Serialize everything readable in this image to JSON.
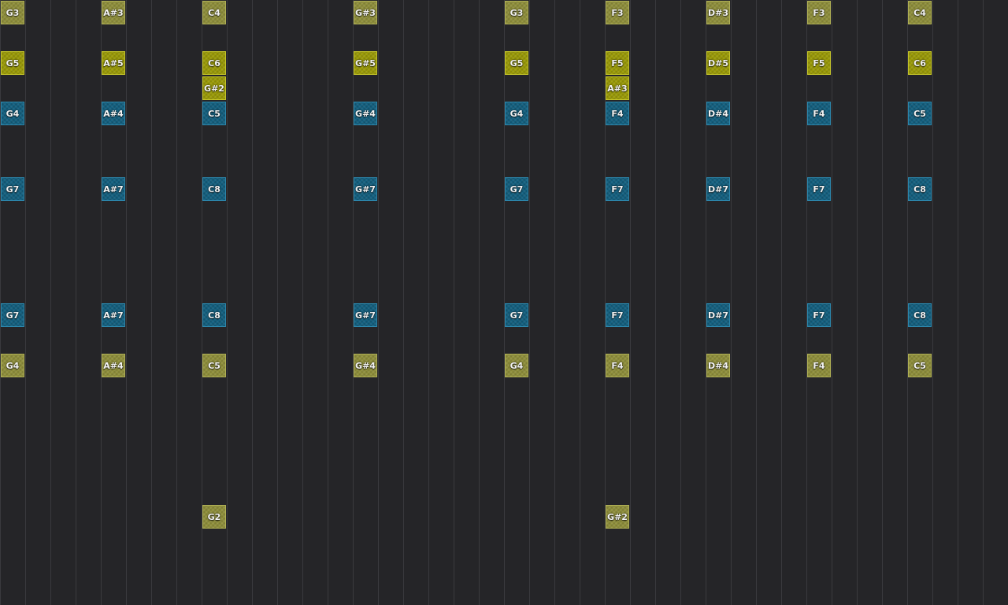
{
  "colors": {
    "background": "#252528",
    "gridline": "#3a3a3e",
    "olive": "#8e8e3a",
    "yellow": "#9a9a06",
    "blue": "#136080"
  },
  "columns": [
    {
      "rows": [
        {
          "label": "G3",
          "kind": "olive"
        },
        {
          "label": "G5",
          "kind": "yellow"
        },
        {
          "label": "G4",
          "kind": "blue"
        },
        {
          "label": "G7",
          "kind": "blue"
        },
        {
          "label": "G7",
          "kind": "blue"
        },
        {
          "label": "G4",
          "kind": "olive"
        }
      ]
    },
    {
      "rows": [
        {
          "label": "A#3",
          "kind": "olive"
        },
        {
          "label": "A#5",
          "kind": "yellow"
        },
        {
          "label": "A#4",
          "kind": "blue"
        },
        {
          "label": "A#7",
          "kind": "blue"
        },
        {
          "label": "A#7",
          "kind": "blue"
        },
        {
          "label": "A#4",
          "kind": "olive"
        }
      ]
    },
    {
      "rows": [
        {
          "label": "C4",
          "kind": "olive"
        },
        {
          "label": "C6",
          "kind": "yellow"
        },
        {
          "label": "G#2",
          "kind": "yellow"
        },
        {
          "label": "C5",
          "kind": "blue"
        },
        {
          "label": "C8",
          "kind": "blue"
        },
        {
          "label": "C8",
          "kind": "blue"
        },
        {
          "label": "C5",
          "kind": "olive"
        },
        {
          "label": "G2",
          "kind": "olive"
        }
      ]
    },
    {
      "rows": [
        {
          "label": "G#3",
          "kind": "olive"
        },
        {
          "label": "G#5",
          "kind": "yellow"
        },
        {
          "label": "G#4",
          "kind": "blue"
        },
        {
          "label": "G#7",
          "kind": "blue"
        },
        {
          "label": "G#7",
          "kind": "blue"
        },
        {
          "label": "G#4",
          "kind": "olive"
        }
      ]
    },
    {
      "rows": [
        {
          "label": "G3",
          "kind": "olive"
        },
        {
          "label": "G5",
          "kind": "yellow"
        },
        {
          "label": "G4",
          "kind": "blue"
        },
        {
          "label": "G7",
          "kind": "blue"
        },
        {
          "label": "G7",
          "kind": "blue"
        },
        {
          "label": "G4",
          "kind": "olive"
        }
      ]
    },
    {
      "rows": [
        {
          "label": "F3",
          "kind": "olive"
        },
        {
          "label": "F5",
          "kind": "yellow"
        },
        {
          "label": "A#3",
          "kind": "yellow"
        },
        {
          "label": "F4",
          "kind": "blue"
        },
        {
          "label": "F7",
          "kind": "blue"
        },
        {
          "label": "F7",
          "kind": "blue"
        },
        {
          "label": "F4",
          "kind": "olive"
        },
        {
          "label": "G#2",
          "kind": "olive"
        }
      ]
    },
    {
      "rows": [
        {
          "label": "D#3",
          "kind": "olive"
        },
        {
          "label": "D#5",
          "kind": "yellow"
        },
        {
          "label": "D#4",
          "kind": "blue"
        },
        {
          "label": "D#7",
          "kind": "blue"
        },
        {
          "label": "D#7",
          "kind": "blue"
        },
        {
          "label": "D#4",
          "kind": "olive"
        }
      ]
    },
    {
      "rows": [
        {
          "label": "F3",
          "kind": "olive"
        },
        {
          "label": "F5",
          "kind": "yellow"
        },
        {
          "label": "F4",
          "kind": "blue"
        },
        {
          "label": "F7",
          "kind": "blue"
        },
        {
          "label": "F7",
          "kind": "blue"
        },
        {
          "label": "F4",
          "kind": "olive"
        }
      ]
    },
    {
      "rows": [
        {
          "label": "C4",
          "kind": "olive"
        },
        {
          "label": "C6",
          "kind": "yellow"
        },
        {
          "label": "C5",
          "kind": "blue"
        },
        {
          "label": "C8",
          "kind": "blue"
        },
        {
          "label": "C8",
          "kind": "blue"
        },
        {
          "label": "C5",
          "kind": "olive"
        }
      ]
    }
  ]
}
